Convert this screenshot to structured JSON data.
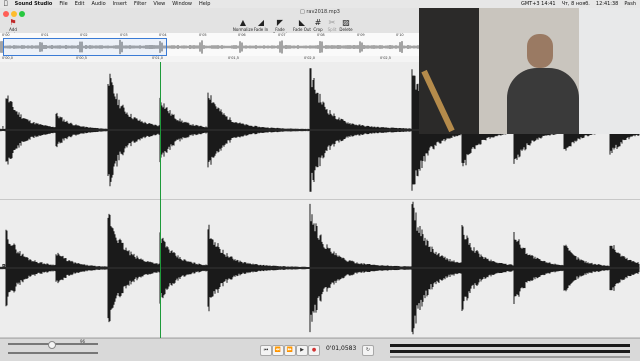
{
  "menubar": {
    "apple": "",
    "items": [
      "Sound Studio",
      "File",
      "Edit",
      "Audio",
      "Insert",
      "Filter",
      "View",
      "Window",
      "Help"
    ],
    "right_items": [
      "GMT+3 14:41",
      "Чт, 8 нояб.",
      "12:41:38",
      "Pash"
    ]
  },
  "window": {
    "title": "rav2018.mp3"
  },
  "toolbar": {
    "add_marker": "Add Marker",
    "normalize": "Normalize",
    "fade_in": "Fade In",
    "fade_special": "Fade Special",
    "fade_out": "Fade Out",
    "crop": "Crop",
    "split": "Split",
    "delete": "Delete"
  },
  "overview": {
    "ticks": [
      "0'00",
      "0'01",
      "0'02",
      "0'03",
      "0'04",
      "0'05",
      "0'06",
      "0'07",
      "0'08",
      "0'09",
      "0'10"
    ]
  },
  "time_ruler": {
    "ticks": [
      "0'00,0",
      "0'00,5",
      "0'01,0",
      "0'01,5",
      "0'02,0",
      "0'02,5"
    ]
  },
  "channels": {
    "left_label": "L",
    "right_label": "R"
  },
  "transport": {
    "time": "0'01,0583",
    "zoom_value": "96"
  },
  "colors": {
    "waveform": "#1a1a1a",
    "waveform_bg": "#ededed",
    "selection": "#3a7bd5",
    "playhead": "#1e9a3a",
    "record": "#d23434"
  },
  "overlay": {
    "description_icon": "webcam-video-overlay"
  }
}
